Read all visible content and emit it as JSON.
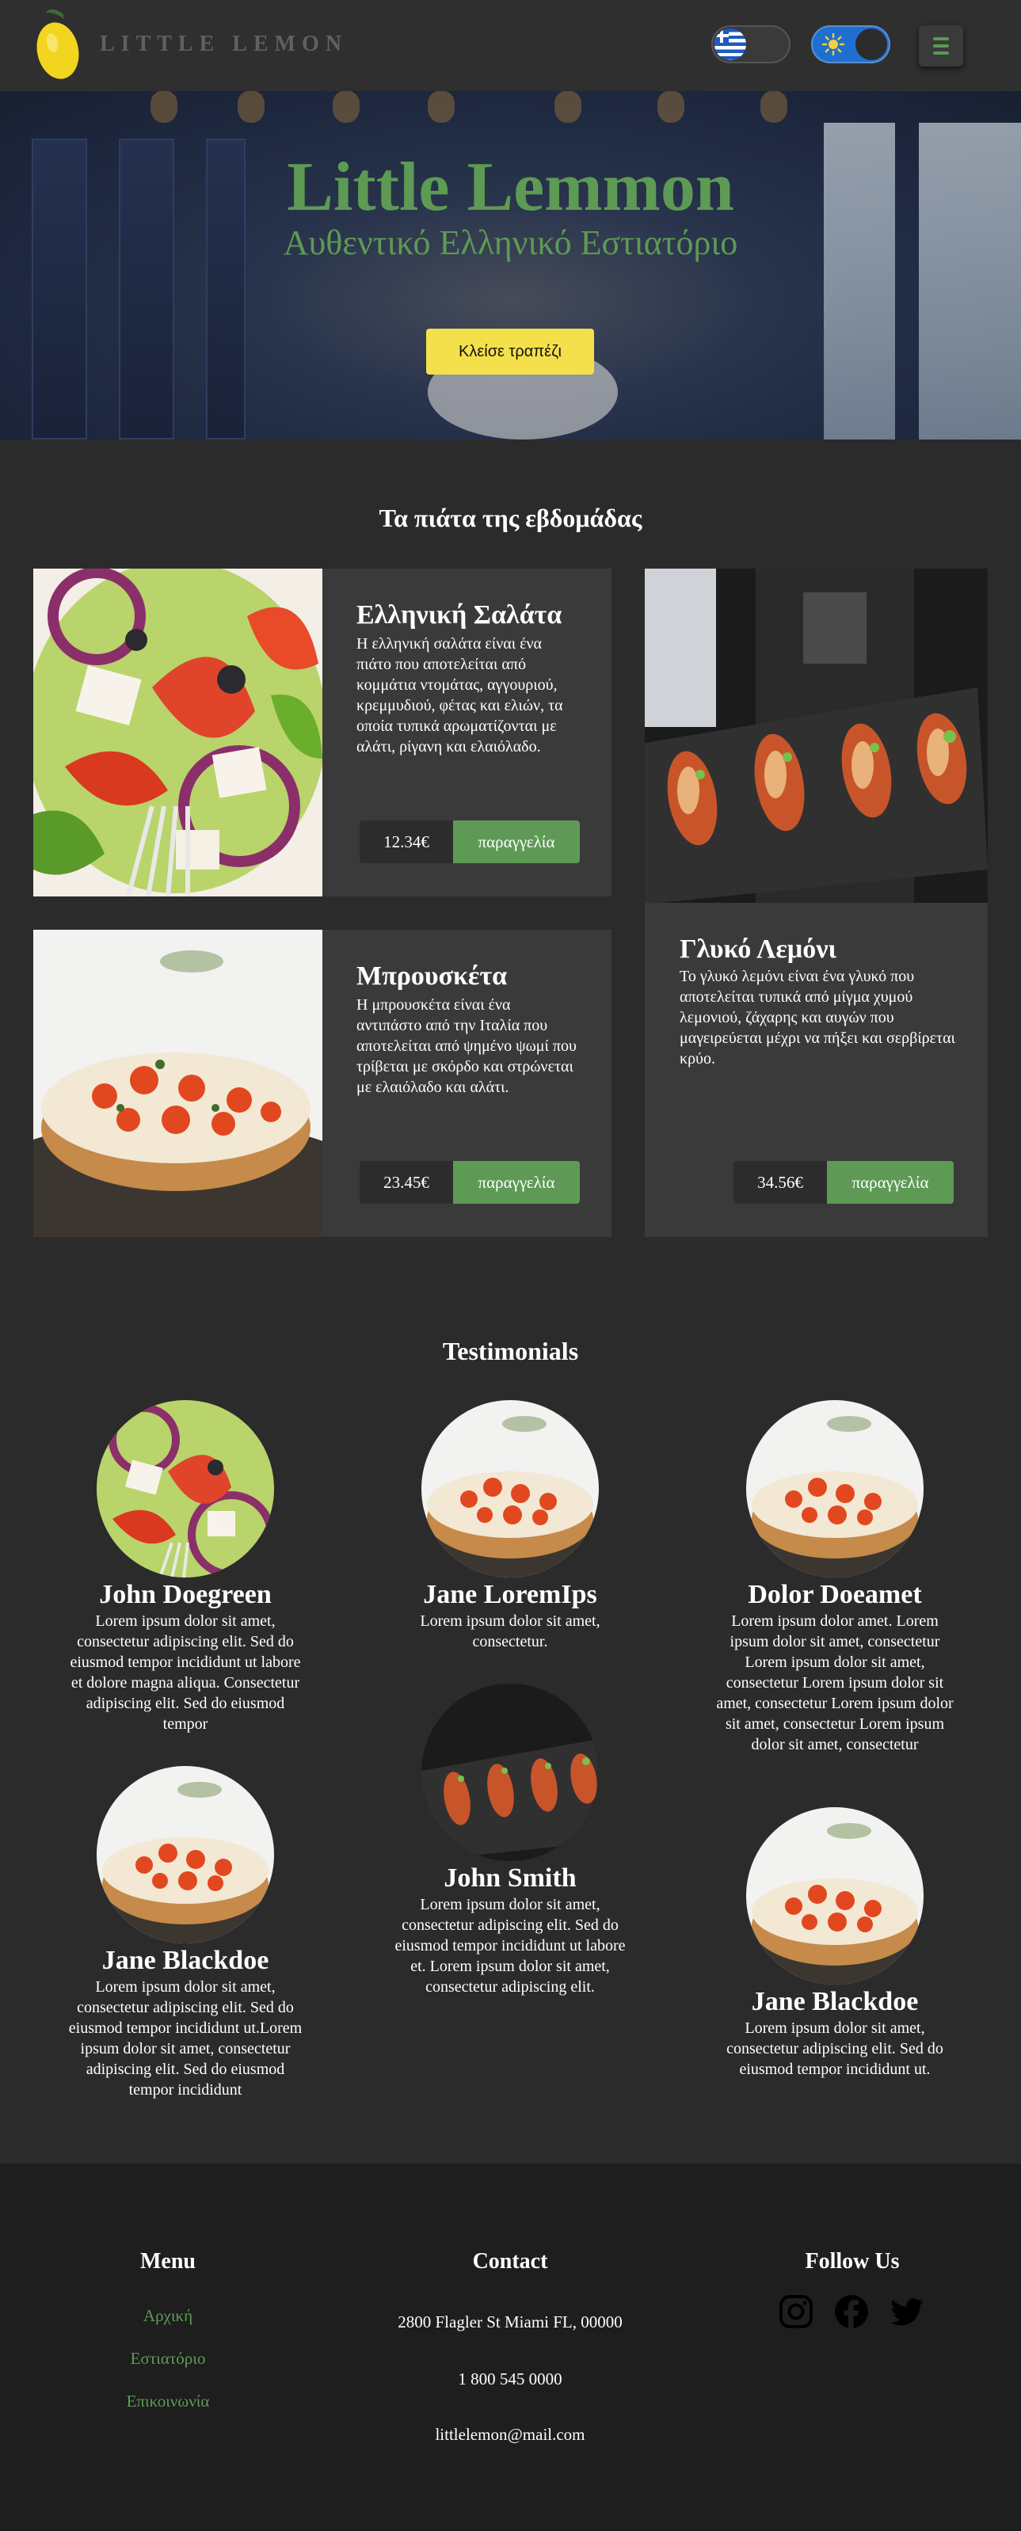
{
  "header": {
    "brand": "LITTLE LEMON",
    "icons": {
      "logo": "lemon-logo",
      "language": "greek-flag-icon",
      "theme": "sun-icon",
      "menu": "hamburger-menu-icon"
    }
  },
  "hero": {
    "title": "Little Lemmon",
    "subtitle": "Αυθεντικό Ελληνικό Εστιατόριο",
    "reserve_label": "Κλείσε τραπέζι"
  },
  "specials": {
    "title": "Τα πιάτα της εβδομάδας",
    "order_label": "παραγγελία",
    "items": [
      {
        "name": "Ελληνική Σαλάτα",
        "description": "Η ελληνική σαλάτα είναι ένα πιάτο που αποτελείται από κομμάτια ντομάτας, αγγουριού, κρεμμυδιού, φέτας και ελιών, τα οποία τυπικά αρωματίζονται με αλάτι, ρίγανη και ελαιόλαδο.",
        "price": "12.34€"
      },
      {
        "name": "Γλυκό Λεμόνι",
        "description": "Το γλυκό λεμόνι είναι ένα γλυκό που αποτελείται τυπικά από μίγμα χυμού λεμονιού, ζάχαρης και αυγών που μαγειρεύεται μέχρι να πήξει και σερβίρεται κρύο.",
        "price": "34.56€"
      },
      {
        "name": "Μπρουσκέτα",
        "description": "Η μπρουσκέτα είναι ένα αντιπάστο από την Ιταλία που αποτελείται από ψημένο ψωμί που τρίβεται με σκόρδο και στρώνεται με ελαιόλαδο και αλάτι.",
        "price": "23.45€"
      }
    ]
  },
  "testimonials": {
    "title": "Testimonials",
    "items": [
      {
        "name": "John Doegreen",
        "text": "Lorem ipsum dolor sit amet, consectetur adipiscing elit. Sed do eiusmod tempor incididunt ut labore et dolore magna aliqua. Consectetur adipiscing elit. Sed do eiusmod tempor"
      },
      {
        "name": "Jane LoremIps",
        "text": "Lorem ipsum dolor sit amet, consectetur."
      },
      {
        "name": "Dolor Doeamet",
        "text": "Lorem ipsum dolor amet. Lorem ipsum dolor sit amet, consectetur Lorem ipsum dolor sit amet, consectetur Lorem ipsum dolor sit amet, consectetur Lorem ipsum dolor sit amet, consectetur Lorem ipsum dolor sit amet, consectetur"
      },
      {
        "name": "Jane Blackdoe",
        "text": "Lorem ipsum dolor sit amet, consectetur adipiscing elit. Sed do eiusmod tempor incididunt ut.Lorem ipsum dolor sit amet, consectetur adipiscing elit. Sed do eiusmod tempor incididunt"
      },
      {
        "name": "John Smith",
        "text": "Lorem ipsum dolor sit amet, consectetur adipiscing elit. Sed do eiusmod tempor incididunt ut labore et. Lorem ipsum dolor sit amet, consectetur adipiscing elit."
      },
      {
        "name": "Jane Blackdoe",
        "text": "Lorem ipsum dolor sit amet, consectetur adipiscing elit. Sed do eiusmod tempor incididunt ut."
      }
    ]
  },
  "footer": {
    "menu_title": "Menu",
    "menu_links": [
      "Αρχική",
      "Εστιατόριο",
      "Επικοινωνία"
    ],
    "contact_title": "Contact",
    "address": "2800 Flagler St Miami FL, 00000",
    "phone": "1 800 545 0000",
    "email": "littlelemon@mail.com",
    "follow_title": "Follow Us",
    "social_icons": [
      "instagram-icon",
      "facebook-icon",
      "twitter-icon"
    ]
  },
  "colors": {
    "accent_green": "#5e9a56",
    "button_yellow": "#f4e04a",
    "background": "#2b2b2b",
    "card": "#3a3a3a",
    "footer": "#1e1e1e"
  }
}
